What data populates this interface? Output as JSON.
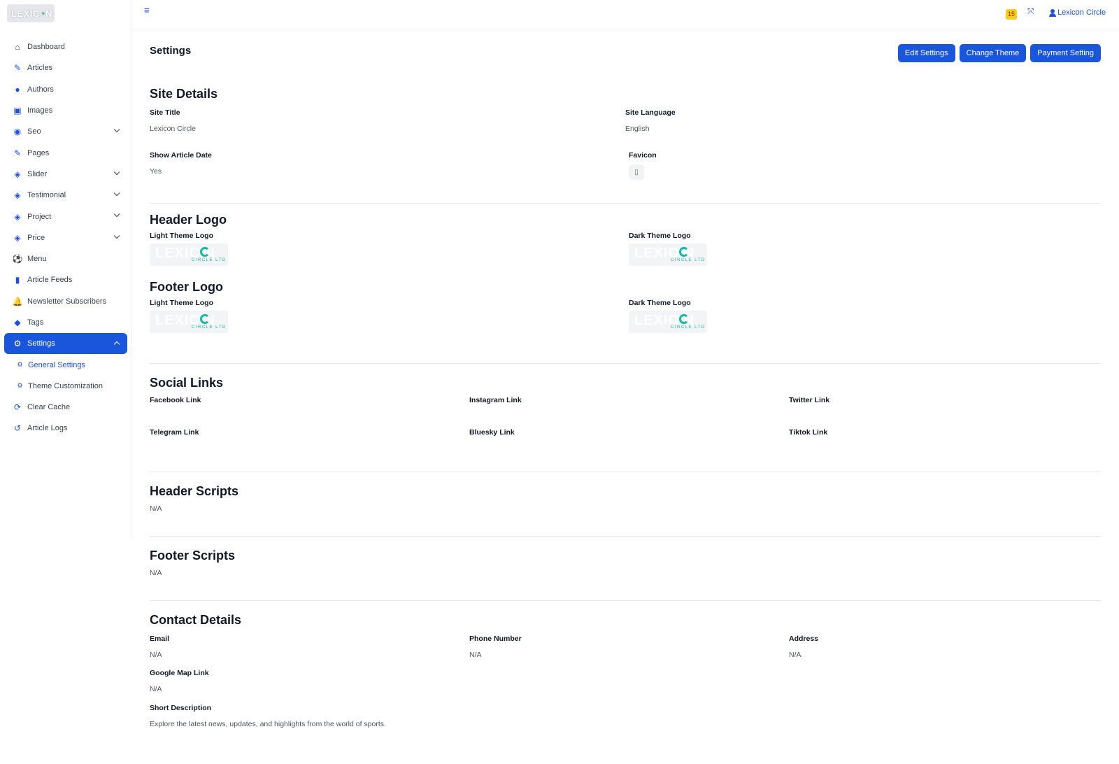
{
  "brand": {
    "logo_text": "LEXIC",
    "logo_accent": "N"
  },
  "sidebar": {
    "items": [
      {
        "label": "Dashboard",
        "icon": "home-icon"
      },
      {
        "label": "Articles",
        "icon": "edit-icon"
      },
      {
        "label": "Authors",
        "icon": "user-icon"
      },
      {
        "label": "Images",
        "icon": "image-icon"
      },
      {
        "label": "Seo",
        "icon": "podcast-icon",
        "expandable": true
      },
      {
        "label": "Pages",
        "icon": "edit-icon"
      },
      {
        "label": "Slider",
        "icon": "cube-icon",
        "expandable": true
      },
      {
        "label": "Testimonial",
        "icon": "cube-icon",
        "expandable": true
      },
      {
        "label": "Project",
        "icon": "cube-icon",
        "expandable": true
      },
      {
        "label": "Price",
        "icon": "cube-icon",
        "expandable": true
      },
      {
        "label": "Menu",
        "icon": "ball-icon"
      },
      {
        "label": "Article Feeds",
        "icon": "book-icon"
      },
      {
        "label": "Newsletter Subscribers",
        "icon": "bell-icon"
      },
      {
        "label": "Tags",
        "icon": "tags-icon"
      },
      {
        "label": "Settings",
        "icon": "gear-icon",
        "expandable": true,
        "active": true
      },
      {
        "label": "General Settings",
        "icon": "gear-icon",
        "sub": true,
        "current": true
      },
      {
        "label": "Theme Customization",
        "icon": "gear-icon",
        "sub": true
      },
      {
        "label": "Clear Cache",
        "icon": "sync-icon"
      },
      {
        "label": "Article Logs",
        "icon": "history-icon"
      }
    ]
  },
  "topbar": {
    "notification_count": "15",
    "user_name": "Lexicon Circle"
  },
  "page": {
    "title": "Settings",
    "buttons": {
      "edit": "Edit Settings",
      "theme": "Change Theme",
      "payment": "Payment Setting"
    }
  },
  "site_details": {
    "title": "Site Details",
    "site_title_label": "Site Title",
    "site_title_value": "Lexicon Circle",
    "site_language_label": "Site Language",
    "site_language_value": "English",
    "show_date_label": "Show Article Date",
    "show_date_value": "Yes",
    "favicon_label": "Favicon"
  },
  "header_logo": {
    "title": "Header Logo",
    "light_label": "Light Theme Logo",
    "dark_label": "Dark Theme Logo"
  },
  "footer_logo": {
    "title": "Footer Logo",
    "light_label": "Light Theme Logo",
    "dark_label": "Dark Theme Logo"
  },
  "logo_thumb": {
    "text": "LEXIC N",
    "sub": "CIRCLE LTD"
  },
  "social": {
    "title": "Social Links",
    "facebook": "Facebook Link",
    "instagram": "Instagram Link",
    "twitter": "Twitter Link",
    "telegram": "Telegram Link",
    "bluesky": "Bluesky Link",
    "tiktok": "Tiktok Link"
  },
  "header_scripts": {
    "title": "Header Scripts",
    "value": "N/A"
  },
  "footer_scripts": {
    "title": "Footer Scripts",
    "value": "N/A"
  },
  "contact": {
    "title": "Contact Details",
    "email_label": "Email",
    "email_value": "N/A",
    "phone_label": "Phone Number",
    "phone_value": "N/A",
    "address_label": "Address",
    "address_value": "N/A",
    "map_label": "Google Map Link",
    "map_value": "N/A",
    "desc_label": "Short Description",
    "desc_value": "Explore the latest news, updates, and highlights from the world of sports."
  },
  "colors": {
    "primary": "#1a56db",
    "accent": "#14b8a6",
    "badge": "#facc15"
  }
}
